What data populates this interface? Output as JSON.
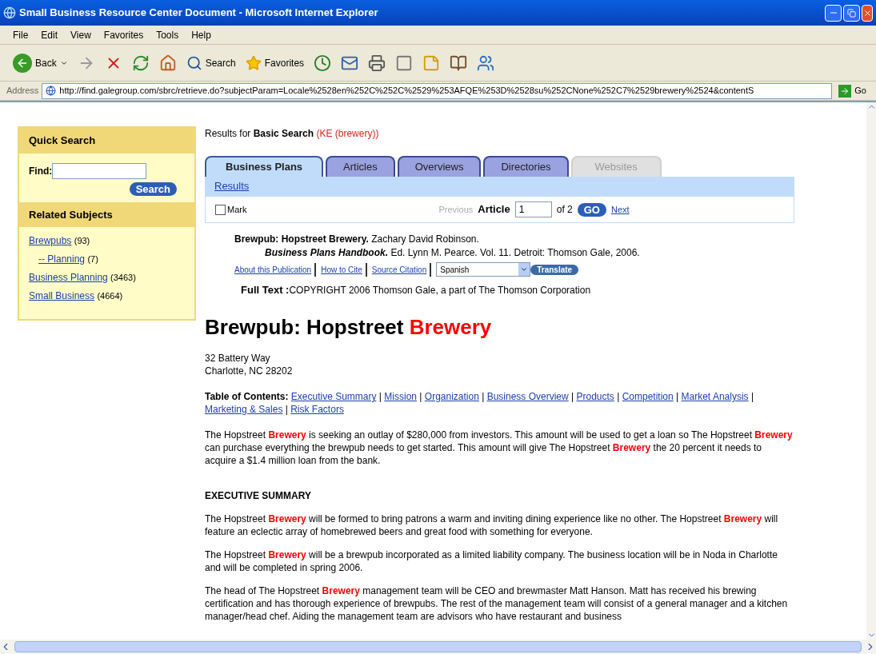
{
  "window": {
    "title": "Small Business Resource Center Document - Microsoft Internet Explorer"
  },
  "menu": [
    "File",
    "Edit",
    "View",
    "Favorites",
    "Tools",
    "Help"
  ],
  "toolbar": {
    "back": "Back",
    "search": "Search",
    "favorites": "Favorites"
  },
  "address": {
    "label": "Address",
    "url": "http://find.galegroup.com/sbrc/retrieve.do?subjectParam=Locale%2528en%252C%252C%2529%253AFQE%253D%2528su%252CNone%252C7%2529brewery%2524&contentS",
    "go": "Go"
  },
  "sidebar": {
    "quick_search": {
      "title": "Quick Search",
      "find_label": "Find:",
      "button": "Search"
    },
    "related": {
      "title": "Related Subjects",
      "items": [
        {
          "label": "Brewpubs",
          "count": "(93)",
          "children": [
            {
              "label": "-- Planning",
              "count": "(7)"
            }
          ]
        },
        {
          "label": "Business Planning",
          "count": "(3463)"
        },
        {
          "label": "Small Business",
          "count": "(4664)"
        }
      ]
    }
  },
  "results_for": {
    "prefix": "Results for",
    "search": "Basic Search",
    "query": "(KE (brewery))"
  },
  "tabs": [
    {
      "label": "Business Plans",
      "selected": true,
      "disabled": false
    },
    {
      "label": "Articles",
      "selected": false,
      "disabled": false
    },
    {
      "label": "Overviews",
      "selected": false,
      "disabled": false
    },
    {
      "label": "Directories",
      "selected": false,
      "disabled": false
    },
    {
      "label": "Websites",
      "selected": false,
      "disabled": true
    }
  ],
  "results_link": "Results",
  "pager": {
    "mark": "Mark",
    "checked": false,
    "previous": "Previous",
    "previous_disabled": true,
    "article": "Article",
    "value": "1",
    "of": "of 2",
    "go": "GO",
    "next": "Next"
  },
  "citation": {
    "line1": "**Brewpub: Hopstreet Brewery.** Zachary David Robinson.",
    "line2": "**Business Plans Handbook.** Ed. Lynn M. Pearce. Vol. 11. Detroit: Thomson Gale, 2006."
  },
  "links": [
    "About this Publication",
    "How to Cite",
    "Source Citation"
  ],
  "language": "Spanish",
  "translate": "Translate",
  "full_text": {
    "label": "Full Text :",
    "text": "COPYRIGHT 2006 Thomson Gale, a part of The Thomson Corporation"
  },
  "heading": "Brewpub: Hopstreet **Brewery**",
  "address_lines": [
    "32 Battery Way",
    "Charlotte, NC 28202"
  ],
  "toc": {
    "label": "Table of Contents:",
    "items": [
      {
        "label": "Executive Summary",
        "separator": "|"
      },
      {
        "label": "Mission",
        "separator": "|"
      },
      {
        "label": "Organization",
        "separator": "|"
      },
      {
        "label": "Business Overview",
        "separator": "|"
      },
      {
        "label": "Products",
        "separator": "|"
      },
      {
        "label": "Competition",
        "separator": "|"
      },
      {
        "label": "Market Analysis",
        "separator": "|"
      },
      {
        "label": "Marketing & Sales",
        "separator": "|"
      },
      {
        "label": "Risk Factors"
      }
    ]
  },
  "intro": "The Hopstreet **Brewery** is seeking an outlay of $280,000 from investors. This amount will be used to get a loan so The Hopstreet **Brewery** can purchase everything the brewpub needs to get started. This amount will give The Hopstreet **Brewery** the 20 percent it needs to acquire a $1.4 million loan from the bank.",
  "section_title": "EXECUTIVE SUMMARY",
  "paragraphs": [
    "The Hopstreet **Brewery** will be formed to bring patrons a warm and inviting dining experience like no other. The Hopstreet **Brewery** will feature an eclectic array of homebrewed beers and great food with something for everyone.",
    "The Hopstreet **Brewery** will be a brewpub incorporated as a limited liability company. The business location will be in Noda in Charlotte and will be completed in spring 2006.",
    "The head of The Hopstreet **Brewery** management team will be CEO and brewmaster Matt Hanson. Matt has received his brewing certification and has thorough experience of brewpubs. The rest of the management team will consist of a general manager and a kitchen manager/head chef. Aiding the management team are advisors who have restaurant and business"
  ]
}
